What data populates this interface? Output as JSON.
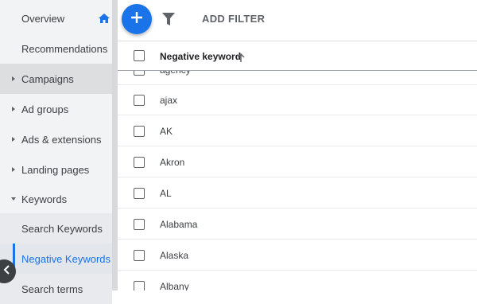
{
  "sidebar": {
    "items": [
      {
        "label": "Overview"
      },
      {
        "label": "Recommendations"
      },
      {
        "label": "Campaigns"
      },
      {
        "label": "Ad groups"
      },
      {
        "label": "Ads & extensions"
      },
      {
        "label": "Landing pages"
      },
      {
        "label": "Keywords"
      },
      {
        "label": "Search Keywords"
      },
      {
        "label": "Negative Keywords"
      },
      {
        "label": "Search terms"
      }
    ]
  },
  "toolbar": {
    "add_filter_label": "ADD FILTER"
  },
  "table": {
    "header": "Negative keyword",
    "rows": [
      "agency",
      "ajax",
      "AK",
      "Akron",
      "AL",
      "Alabama",
      "Alaska",
      "Albany"
    ]
  },
  "colors": {
    "accent": "#1a73e8",
    "sidebar_bg": "#f1f3f4"
  },
  "icons": [
    "home-icon",
    "add-icon",
    "filter-icon",
    "sort-up-icon",
    "chevron-left-icon"
  ]
}
